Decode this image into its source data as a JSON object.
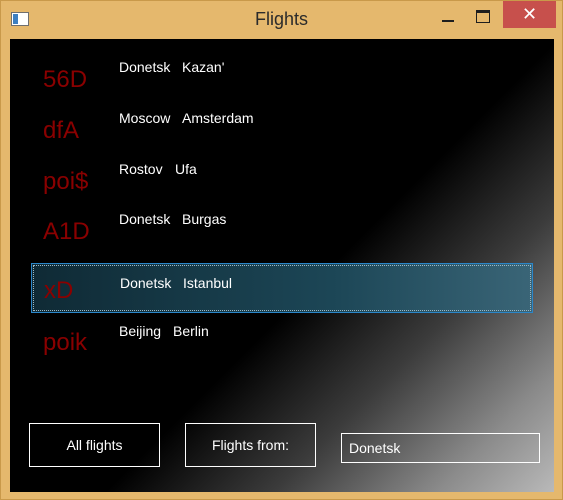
{
  "window": {
    "title": "Flights",
    "close_glyph": "✕",
    "frame_color": "#e5b86d",
    "close_color": "#c7504c"
  },
  "flights": [
    {
      "code": "56D",
      "from": "Donetsk",
      "to": "Kazan'",
      "selected": false
    },
    {
      "code": "dfA",
      "from": "Moscow",
      "to": "Amsterdam",
      "selected": false
    },
    {
      "code": "poi$",
      "from": "Rostov",
      "to": "Ufa",
      "selected": false
    },
    {
      "code": "A1D",
      "from": "Donetsk",
      "to": "Burgas",
      "selected": false
    },
    {
      "code": "xD",
      "from": "Donetsk",
      "to": "Istanbul",
      "selected": true
    },
    {
      "code": "poik",
      "from": "Beijing",
      "to": "Berlin",
      "selected": false
    }
  ],
  "colors": {
    "code_text": "#8a0000",
    "selection_border": "#2a86c9"
  },
  "controls": {
    "all_flights_label": "All flights",
    "flights_from_label": "Flights from:",
    "city_value": "Donetsk"
  }
}
